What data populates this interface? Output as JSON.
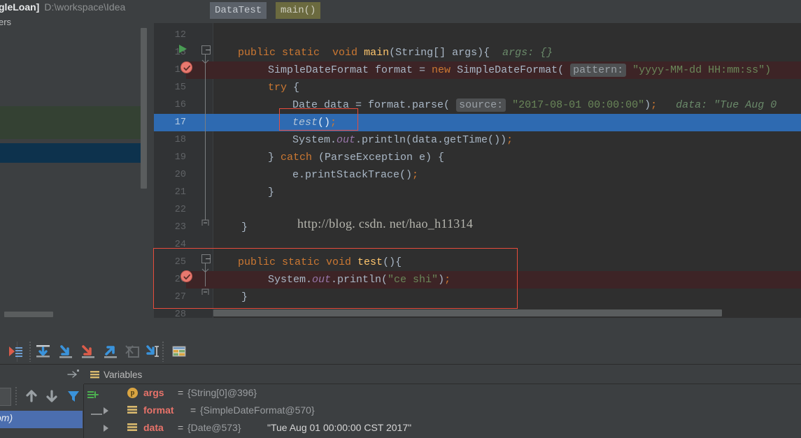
{
  "window": {
    "title_bold": "gleLoan]",
    "title_path": "D:\\workspace\\Idea",
    "title_line2": "ers"
  },
  "breadcrumbs": [
    {
      "label": "DataTest",
      "name": "breadcrumb-class"
    },
    {
      "label": "main()",
      "name": "breadcrumb-method"
    }
  ],
  "editor": {
    "watermark": "http://blog. csdn. net/hao_h11314",
    "lines": [
      {
        "no": "12",
        "text": ""
      },
      {
        "no": "13",
        "text": "public static  void main(String[] args){"
      },
      {
        "no": "14",
        "text": "SimpleDateFormat format = new SimpleDateFormat( pattern: \"yyyy-MM-dd HH:mm:ss\")"
      },
      {
        "no": "15",
        "text": "try {"
      },
      {
        "no": "16",
        "text": "Date data = format.parse( source: \"2017-08-01 00:00:00\");   data: \"Tue Aug 0"
      },
      {
        "no": "17",
        "text": "test();"
      },
      {
        "no": "18",
        "text": "System.out.println(data.getTime());"
      },
      {
        "no": "19",
        "text": "} catch (ParseException e) {"
      },
      {
        "no": "20",
        "text": "e.printStackTrace();"
      },
      {
        "no": "21",
        "text": "}"
      },
      {
        "no": "22",
        "text": ""
      },
      {
        "no": "23",
        "text": "}"
      },
      {
        "no": "24",
        "text": ""
      },
      {
        "no": "25",
        "text": "public static void test(){"
      },
      {
        "no": "26",
        "text": "System.out.println(\"ce shi\");"
      },
      {
        "no": "27",
        "text": "}"
      },
      {
        "no": "28",
        "text": ""
      }
    ],
    "inlay_hints": {
      "args": "args: {}",
      "pattern": "pattern:",
      "source": "source:",
      "data": "data: \"Tue Aug 0"
    },
    "strings": {
      "pattern_value": "\"yyyy-MM-dd HH:mm:ss\")",
      "source_value": "\"2017-08-01 00:00:00\")",
      "ce_shi": "\"ce shi\""
    }
  },
  "toolbar": {
    "buttons": [
      {
        "name": "show-execution-point-button",
        "title": "Show Execution Point"
      },
      {
        "name": "step-over-button",
        "title": "Step Over"
      },
      {
        "name": "step-into-button",
        "title": "Step Into"
      },
      {
        "name": "force-step-into-button",
        "title": "Force Step Into"
      },
      {
        "name": "step-out-button",
        "title": "Step Out"
      },
      {
        "name": "drop-frame-button",
        "title": "Drop Frame"
      },
      {
        "name": "run-to-cursor-button",
        "title": "Run to Cursor"
      },
      {
        "name": "evaluate-expression-button",
        "title": "Evaluate Expression"
      }
    ]
  },
  "variables_panel": {
    "tab_label": "Variables",
    "rows": [
      {
        "icon": "p",
        "expandable": false,
        "name": "args",
        "eq": "=",
        "value": "{String[0]@396}",
        "str": ""
      },
      {
        "icon": "obj",
        "expandable": true,
        "name": "format",
        "eq": "=",
        "value": "{SimpleDateFormat@570}",
        "str": ""
      },
      {
        "icon": "obj",
        "expandable": true,
        "name": "data",
        "eq": "=",
        "value": "{Date@573}",
        "str": "\"Tue Aug 01 00:00:00 CST 2017\""
      }
    ]
  },
  "frames": {
    "selected_text": "om)"
  },
  "colors": {
    "editor_bg": "#2f2f2f",
    "gutter_bg": "#313335",
    "panel_bg": "#3c3f41",
    "selection_blue": "#2e6ab1",
    "breakpoint_row": "#3d2426",
    "annotation_red": "#e74c3c",
    "frame_selected": "#4b6eaf",
    "keyword_orange": "#cc7832",
    "string_green": "#6a8759",
    "method_yellow": "#ffc66d",
    "field_purple": "#9876aa",
    "var_name_red": "#e8736a"
  }
}
